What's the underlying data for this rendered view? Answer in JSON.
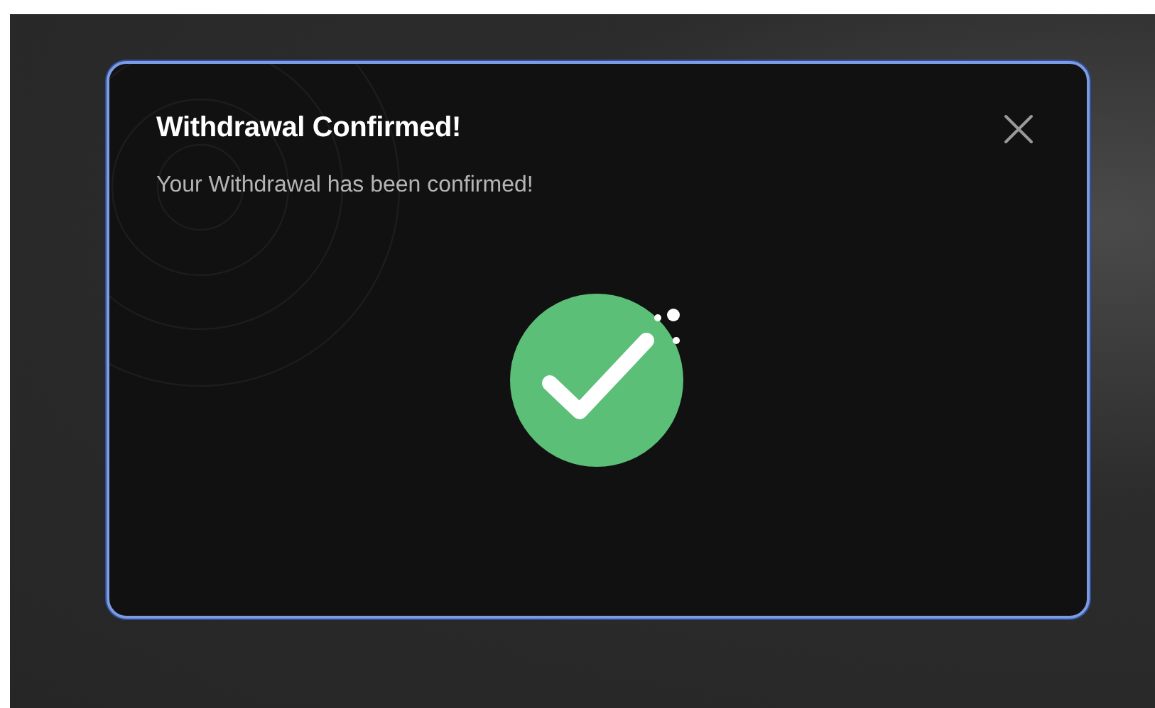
{
  "dialog": {
    "title": "Withdrawal Confirmed!",
    "message": "Your Withdrawal has been confirmed!"
  }
}
